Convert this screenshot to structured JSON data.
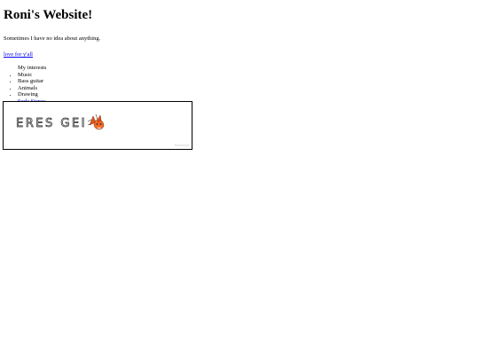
{
  "header": {
    "title": "Roni's Website!"
  },
  "intro": {
    "tagline": "Sometimes I have no idea about anything."
  },
  "links": {
    "love": "love for y'all"
  },
  "interests": {
    "heading": "My interests",
    "items": [
      {
        "label": "Music",
        "is_link": false
      },
      {
        "label": "Bass guitar",
        "is_link": false
      },
      {
        "label": "Animals",
        "is_link": false
      },
      {
        "label": "Drawing",
        "is_link": false
      },
      {
        "label": "Soda Stereo",
        "is_link": true
      }
    ]
  },
  "drawing": {
    "text": "ERES GEI",
    "watermark": "flockmod"
  },
  "colors": {
    "link": "#0000ee",
    "text": "#000000",
    "fox": "#e0561b"
  }
}
